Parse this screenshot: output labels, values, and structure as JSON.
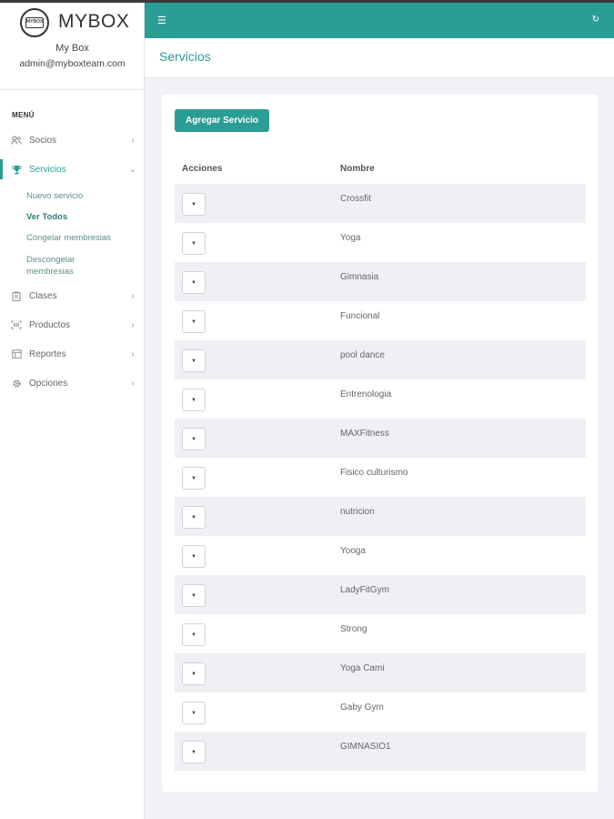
{
  "brand": {
    "name": "MYBOX",
    "logo_text": "MYBOX",
    "box_name": "My Box",
    "user_email": "admin@myboxteam.com"
  },
  "sidebar": {
    "menu_title": "MENÚ",
    "items": [
      {
        "label": "Socios",
        "icon": "users-icon"
      },
      {
        "label": "Servicios",
        "icon": "trophy-icon",
        "active": true
      },
      {
        "label": "Clases",
        "icon": "clipboard-icon"
      },
      {
        "label": "Productos",
        "icon": "barcode-icon"
      },
      {
        "label": "Reportes",
        "icon": "report-icon"
      },
      {
        "label": "Opciones",
        "icon": "gear-icon"
      }
    ],
    "sub_items": [
      {
        "label": "Nuevo servicio"
      },
      {
        "label": "Ver Todos",
        "current": true
      },
      {
        "label": "Congelar membresias"
      },
      {
        "label": "Descongelar membresias"
      }
    ]
  },
  "header": {
    "menu_icon": "hamburger-icon",
    "refresh_icon": "refresh-icon"
  },
  "page": {
    "title": "Servicios"
  },
  "actions": {
    "add_label": "Agregar Servicio"
  },
  "table": {
    "headers": {
      "actions": "Acciones",
      "name": "Nombre"
    },
    "rows": [
      "Crossfit",
      "Yoga",
      "Gimnasia",
      "Funcional",
      "pool dance",
      "Entrenologia",
      "MAXFitness",
      "Fisico culturismo",
      "nutricion",
      "Yooga",
      "LadyFitGym",
      "Strong",
      "Yoga Cami",
      "Gaby Gym",
      "GIMNASIO1"
    ]
  },
  "colors": {
    "accent": "#2a9d95",
    "background": "#f0f2f5",
    "stripe": "#eef0f3"
  }
}
